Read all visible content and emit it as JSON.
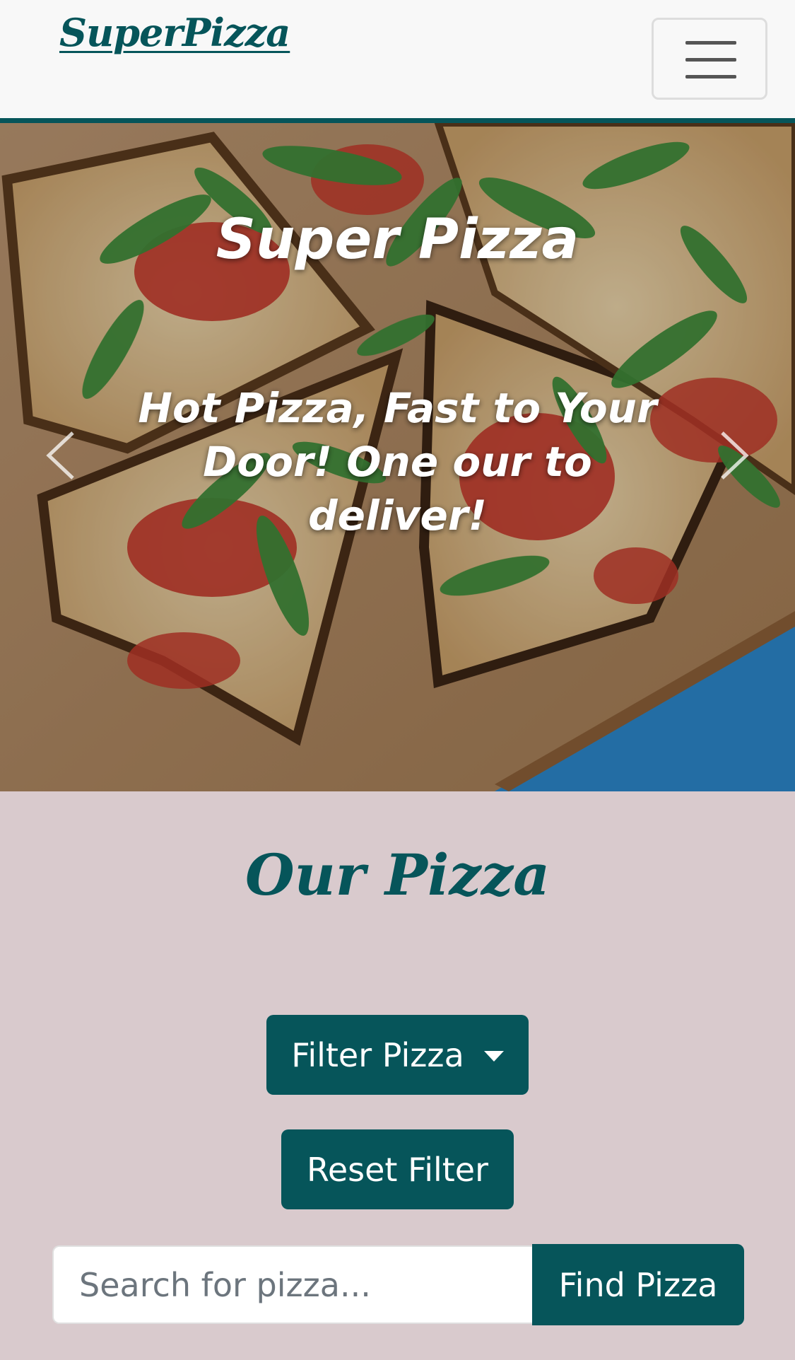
{
  "navbar": {
    "brand": "SuperPizza",
    "toggle_icon": "hamburger-icon"
  },
  "hero": {
    "title": "Super Pizza",
    "caption": "Hot Pizza, Fast to Your Door! One our to deliver!",
    "prev_icon": "chevron-left-icon",
    "next_icon": "chevron-right-icon"
  },
  "section": {
    "title": "Our Pizza"
  },
  "filter": {
    "label": "Filter Pizza",
    "caret_icon": "caret-down-icon"
  },
  "reset": {
    "label": "Reset Filter"
  },
  "search": {
    "placeholder": "Search for pizza...",
    "value": "",
    "button_label": "Find Pizza"
  },
  "colors": {
    "primary": "#06555a",
    "background": "#d9cacd",
    "navbar_bg": "#f8f8f8"
  }
}
